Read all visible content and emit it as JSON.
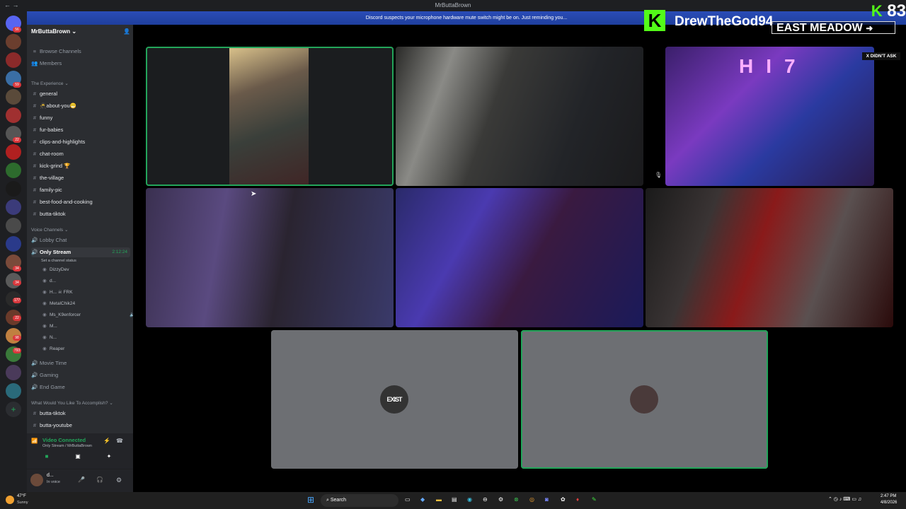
{
  "window": {
    "title": "MrButtaBrown"
  },
  "banner": {
    "text": "Discord suspects your microphone hardware mute switch might be on. Just reminding you..."
  },
  "servers": {
    "badges": [
      "56",
      "59",
      "22",
      "34",
      "177",
      "22",
      "98",
      "34",
      "793"
    ]
  },
  "sidebar": {
    "server_name": "MrButtaBrown",
    "browse": "Browse Channels",
    "members": "Members",
    "cat_experience": "The Experience",
    "text_channels": [
      "general",
      "about-you",
      "funny",
      "fur-babies",
      "clips-and-highlights",
      "chat-room",
      "kick-grind",
      "the-village",
      "family-pic",
      "best-food-and-cooking",
      "butta-tiktok"
    ],
    "cat_voice": "Voice Channels",
    "voice_lobby": "Lobby Chat",
    "voice_active": "Only Stream",
    "voice_timer": "2:12:24",
    "voice_status": "Set a channel status",
    "voice_users": [
      "DizzyDev",
      "d...",
      "H...",
      "MetalChik24",
      "Ms_K9enforcer",
      "M...",
      "N...",
      "Reaper"
    ],
    "voice_user_tag": "FRK",
    "voice_others": [
      "Movie Time",
      "Gaming",
      "End Game"
    ],
    "cat_accomplish": "What Would You Like To Accomplish?",
    "bottom_channels": [
      "butta-tiktok",
      "butta-youtube"
    ]
  },
  "voicebar": {
    "status": "Video Connected",
    "location": "Only Stream / MrButtaBrown"
  },
  "userbar": {
    "name": "d...",
    "status": "In voice"
  },
  "stage": {
    "tile_avatars": [
      "EXIST",
      ""
    ]
  },
  "overlay": {
    "kick_name": "DrewTheGod94",
    "meadow": "EAST MEADOW",
    "didnt_ask": "X DIDN'T ASK",
    "score": "83"
  },
  "taskbar": {
    "weather_temp": "47°F",
    "weather_desc": "Sunny",
    "search": "Search",
    "time": "2:47 PM",
    "date": "4/8/2026"
  },
  "colors": {
    "speaking": "#23a55a",
    "banner": "#2a4cb7",
    "kick": "#53fc18"
  }
}
